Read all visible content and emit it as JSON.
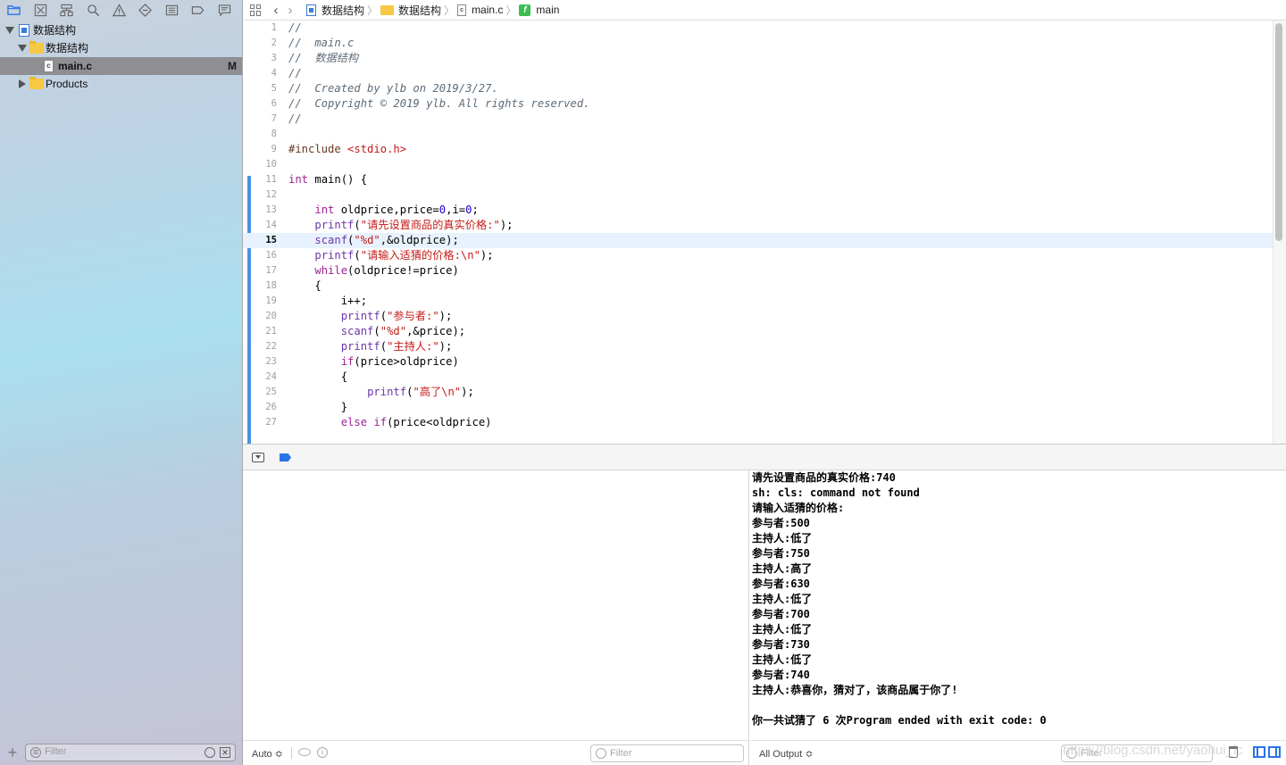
{
  "navigator": {
    "toolbar_icons": [
      "folder-icon",
      "source-control-icon",
      "hierarchy-icon",
      "search-icon",
      "warning-icon",
      "test-icon",
      "debug-icon",
      "breakpoint-icon",
      "report-icon"
    ],
    "tree": [
      {
        "label": "数据结构",
        "type": "project"
      },
      {
        "label": "数据结构",
        "type": "group"
      },
      {
        "label": "main.c",
        "type": "file",
        "badge": "M",
        "selected": true
      },
      {
        "label": "Products",
        "type": "group"
      }
    ],
    "filter_placeholder": "Filter"
  },
  "jumpbar": {
    "crumbs": [
      "数据结构",
      "数据结构",
      "main.c",
      "main"
    ]
  },
  "editor": {
    "current_line": 15,
    "lines": [
      {
        "n": "1"
      },
      {
        "n": "2"
      },
      {
        "n": "3"
      },
      {
        "n": "4"
      },
      {
        "n": "5"
      },
      {
        "n": "6"
      },
      {
        "n": "7"
      },
      {
        "n": "8"
      },
      {
        "n": "9"
      },
      {
        "n": "10"
      },
      {
        "n": "11"
      },
      {
        "n": "12"
      },
      {
        "n": "13"
      },
      {
        "n": "14"
      },
      {
        "n": "15"
      },
      {
        "n": "16"
      },
      {
        "n": "17"
      },
      {
        "n": "18"
      },
      {
        "n": "19"
      },
      {
        "n": "20"
      },
      {
        "n": "21"
      },
      {
        "n": "22"
      },
      {
        "n": "23"
      },
      {
        "n": "24"
      },
      {
        "n": "25"
      },
      {
        "n": "26"
      },
      {
        "n": "27"
      }
    ],
    "code": [
      [
        {
          "t": "//",
          "c": "com"
        }
      ],
      [
        {
          "t": "//  main.c",
          "c": "com"
        }
      ],
      [
        {
          "t": "//  数据结构",
          "c": "com"
        }
      ],
      [
        {
          "t": "//",
          "c": "com"
        }
      ],
      [
        {
          "t": "//  Created by ylb on 2019/3/27.",
          "c": "com"
        }
      ],
      [
        {
          "t": "//  Copyright © 2019 ylb. All rights reserved.",
          "c": "com"
        }
      ],
      [
        {
          "t": "//",
          "c": "com"
        }
      ],
      [],
      [
        {
          "t": "#include ",
          "c": "pp"
        },
        {
          "t": "<stdio.h>",
          "c": "str"
        }
      ],
      [],
      [
        {
          "t": "int",
          "c": "kw"
        },
        {
          "t": " main() {",
          "c": ""
        }
      ],
      [],
      [
        {
          "t": "    ",
          "c": ""
        },
        {
          "t": "int",
          "c": "kw"
        },
        {
          "t": " oldprice,price=",
          "c": ""
        },
        {
          "t": "0",
          "c": "num"
        },
        {
          "t": ",i=",
          "c": ""
        },
        {
          "t": "0",
          "c": "num"
        },
        {
          "t": ";",
          "c": ""
        }
      ],
      [
        {
          "t": "    ",
          "c": ""
        },
        {
          "t": "printf",
          "c": "fn"
        },
        {
          "t": "(",
          "c": ""
        },
        {
          "t": "\"请先设置商品的真实价格:\"",
          "c": "str"
        },
        {
          "t": ");",
          "c": ""
        }
      ],
      [
        {
          "t": "    ",
          "c": ""
        },
        {
          "t": "scanf",
          "c": "fn"
        },
        {
          "t": "(",
          "c": ""
        },
        {
          "t": "\"%d\"",
          "c": "str"
        },
        {
          "t": ",&oldprice);",
          "c": ""
        }
      ],
      [
        {
          "t": "    ",
          "c": ""
        },
        {
          "t": "printf",
          "c": "fn"
        },
        {
          "t": "(",
          "c": ""
        },
        {
          "t": "\"请输入适猜的价格:\\n\"",
          "c": "str"
        },
        {
          "t": ");",
          "c": ""
        }
      ],
      [
        {
          "t": "    ",
          "c": ""
        },
        {
          "t": "while",
          "c": "kw"
        },
        {
          "t": "(oldprice!=price)",
          "c": ""
        }
      ],
      [
        {
          "t": "    {",
          "c": ""
        }
      ],
      [
        {
          "t": "        i++;",
          "c": ""
        }
      ],
      [
        {
          "t": "        ",
          "c": ""
        },
        {
          "t": "printf",
          "c": "fn"
        },
        {
          "t": "(",
          "c": ""
        },
        {
          "t": "\"参与者:\"",
          "c": "str"
        },
        {
          "t": ");",
          "c": ""
        }
      ],
      [
        {
          "t": "        ",
          "c": ""
        },
        {
          "t": "scanf",
          "c": "fn"
        },
        {
          "t": "(",
          "c": ""
        },
        {
          "t": "\"%d\"",
          "c": "str"
        },
        {
          "t": ",&price);",
          "c": ""
        }
      ],
      [
        {
          "t": "        ",
          "c": ""
        },
        {
          "t": "printf",
          "c": "fn"
        },
        {
          "t": "(",
          "c": ""
        },
        {
          "t": "\"主持人:\"",
          "c": "str"
        },
        {
          "t": ");",
          "c": ""
        }
      ],
      [
        {
          "t": "        ",
          "c": ""
        },
        {
          "t": "if",
          "c": "kw"
        },
        {
          "t": "(price>oldprice)",
          "c": ""
        }
      ],
      [
        {
          "t": "        {",
          "c": ""
        }
      ],
      [
        {
          "t": "            ",
          "c": ""
        },
        {
          "t": "printf",
          "c": "fn"
        },
        {
          "t": "(",
          "c": ""
        },
        {
          "t": "\"高了\\n\"",
          "c": "str"
        },
        {
          "t": ");",
          "c": ""
        }
      ],
      [
        {
          "t": "        }",
          "c": ""
        }
      ],
      [
        {
          "t": "        ",
          "c": ""
        },
        {
          "t": "else",
          "c": "kw"
        },
        {
          "t": " ",
          "c": ""
        },
        {
          "t": "if",
          "c": "kw"
        },
        {
          "t": "(price<oldprice)",
          "c": ""
        }
      ]
    ]
  },
  "variables": {
    "scope": "Auto ≎",
    "filter_placeholder": "Filter"
  },
  "console": {
    "lines": [
      "请先设置商品的真实价格:740",
      "sh: cls: command not found",
      "请输入适猜的价格:",
      "参与者:500",
      "主持人:低了",
      "参与者:750",
      "主持人:高了",
      "参与者:630",
      "主持人:低了",
      "参与者:700",
      "主持人:低了",
      "参与者:730",
      "主持人:低了",
      "参与者:740",
      "主持人:恭喜你，猜对了，该商品属于你了!",
      "",
      "你一共试猜了 6 次Program ended with exit code: 0"
    ],
    "output_selector": "All Output ≎",
    "filter_placeholder": "Filter",
    "watermark": "https://blog.csdn.net/yaohui_lc"
  },
  "colors": {
    "accent": "#2b74e6",
    "keyword": "#9b2393",
    "string": "#c41a16",
    "number": "#1c00cf",
    "comment": "#5d6c79",
    "function": "#6c36a9"
  }
}
